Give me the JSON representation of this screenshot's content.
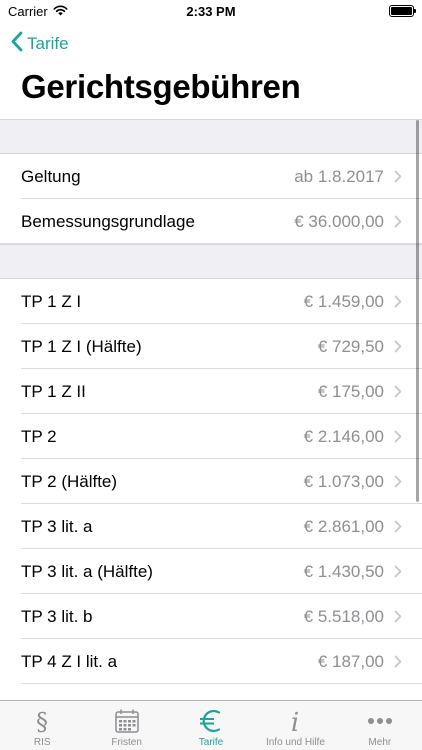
{
  "status_bar": {
    "carrier": "Carrier",
    "time": "2:33 PM"
  },
  "nav": {
    "back_label": "Tarife"
  },
  "page_title": "Gerichtsgebühren",
  "section_1": [
    {
      "label": "Geltung",
      "value": "ab 1.8.2017"
    },
    {
      "label": "Bemessungsgrundlage",
      "value": "€ 36.000,00"
    }
  ],
  "section_2": [
    {
      "label": "TP 1 Z I",
      "value": "€ 1.459,00"
    },
    {
      "label": "TP 1 Z I (Hälfte)",
      "value": "€ 729,50"
    },
    {
      "label": "TP 1 Z II",
      "value": "€ 175,00"
    },
    {
      "label": "TP 2",
      "value": "€ 2.146,00"
    },
    {
      "label": "TP 2 (Hälfte)",
      "value": "€ 1.073,00"
    },
    {
      "label": "TP 3 lit. a",
      "value": "€ 2.861,00"
    },
    {
      "label": "TP 3 lit. a (Hälfte)",
      "value": "€ 1.430,50"
    },
    {
      "label": "TP 3 lit. b",
      "value": "€ 5.518,00"
    },
    {
      "label": "TP 4 Z I lit. a",
      "value": "€ 187,00"
    }
  ],
  "tabs": [
    {
      "label": "RIS",
      "icon": "paragraph-icon"
    },
    {
      "label": "Fristen",
      "icon": "calendar-icon"
    },
    {
      "label": "Tarife",
      "icon": "euro-icon"
    },
    {
      "label": "Info und Hilfe",
      "icon": "info-icon"
    },
    {
      "label": "Mehr",
      "icon": "more-icon"
    }
  ],
  "colors": {
    "accent": "#1aa59a",
    "secondary_text": "#8e8e93",
    "group_background": "#efeff4"
  }
}
